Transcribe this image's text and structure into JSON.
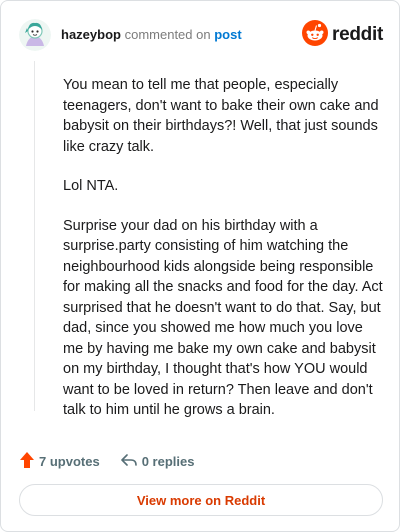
{
  "header": {
    "username": "hazeybop",
    "action_text": "commented on",
    "post_link": "post",
    "brand": "reddit"
  },
  "comment": {
    "paragraphs": [
      "You mean to tell me that people, especially teenagers, don't want to bake their own cake and babysit on their birthdays?! Well, that just sounds like crazy talk.",
      "Lol NTA.",
      "Surprise your dad on his birthday with a surprise.party consisting of him watching the neighbourhood kids alongside being responsible for making all the snacks and food for the day. Act surprised that he doesn't want to do that. Say, but dad, since you showed me how much you love me by having me bake my own cake and babysit on my birthday, I thought that's how YOU would want to be loved in return? Then leave and don't talk to him until he grows a brain."
    ]
  },
  "footer": {
    "upvotes": "7 upvotes",
    "replies": "0 replies",
    "view_more": "View more on Reddit"
  },
  "colors": {
    "brand_orange": "#ff4500",
    "link_blue": "#0079d3",
    "button_text": "#d93a00"
  },
  "icons": {
    "avatar": "snoo-avatar-icon",
    "logo": "reddit-snoo-icon",
    "upvote": "upvote-arrow-icon",
    "reply": "reply-arrow-icon"
  }
}
